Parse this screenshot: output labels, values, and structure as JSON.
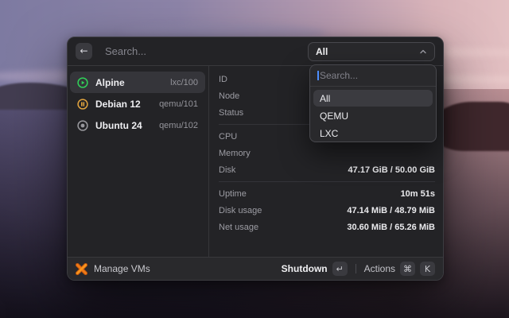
{
  "topbar": {
    "search_placeholder": "Search...",
    "back_icon": "arrow-left",
    "filter_select": {
      "value": "All",
      "chevron_icon": "chevron-up"
    }
  },
  "sidebar": {
    "items": [
      {
        "name": "Alpine",
        "id": "lxc/100",
        "status": "running",
        "status_icon": "play-circle-icon",
        "selected": true
      },
      {
        "name": "Debian 12",
        "id": "qemu/101",
        "status": "paused",
        "status_icon": "pause-circle-icon",
        "selected": false
      },
      {
        "name": "Ubuntu 24",
        "id": "qemu/102",
        "status": "stopped",
        "status_icon": "stop-circle-icon",
        "selected": false
      }
    ]
  },
  "details": {
    "groups": [
      {
        "rows": [
          {
            "label": "ID",
            "value": ""
          },
          {
            "label": "Node",
            "value": ""
          },
          {
            "label": "Status",
            "value": ""
          }
        ]
      },
      {
        "rows": [
          {
            "label": "CPU",
            "value": ""
          },
          {
            "label": "Memory",
            "value": ""
          },
          {
            "label": "Disk",
            "value": "47.17 GiB / 50.00 GiB"
          }
        ]
      },
      {
        "rows": [
          {
            "label": "Uptime",
            "value": "10m 51s"
          },
          {
            "label": "Disk usage",
            "value": "47.14 MiB / 48.79 MiB"
          },
          {
            "label": "Net usage",
            "value": "30.60 MiB / 65.26 MiB"
          }
        ]
      }
    ]
  },
  "dropdown": {
    "search_placeholder": "Search...",
    "options": [
      {
        "label": "All",
        "selected": true
      },
      {
        "label": "QEMU",
        "selected": false
      },
      {
        "label": "LXC",
        "selected": false
      }
    ]
  },
  "footer": {
    "app_label": "Manage VMs",
    "logo": "proxmox-logo",
    "primary_action": {
      "label": "Shutdown",
      "key": "↵"
    },
    "secondary_action": {
      "label": "Actions",
      "keys": [
        "⌘",
        "K"
      ]
    }
  },
  "colors": {
    "window_bg": "#232326",
    "accent_blue_caret": "#4c8dff",
    "status_running_green": "#30d158",
    "status_paused_amber": "#e0a33e",
    "status_stopped_gray": "#98989d",
    "brand_orange": "#ec7211"
  }
}
